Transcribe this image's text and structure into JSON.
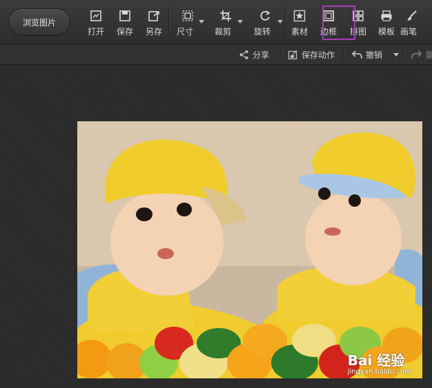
{
  "toolbar": {
    "browse_label": "浏览图片",
    "tools": [
      {
        "name": "open",
        "label": "打开"
      },
      {
        "name": "save",
        "label": "保存"
      },
      {
        "name": "save-as",
        "label": "另存"
      },
      {
        "name": "size",
        "label": "尺寸"
      },
      {
        "name": "crop",
        "label": "裁剪"
      },
      {
        "name": "rotate",
        "label": "旋转"
      },
      {
        "name": "material",
        "label": "素材"
      },
      {
        "name": "border",
        "label": "边框"
      },
      {
        "name": "collage",
        "label": "拼图"
      },
      {
        "name": "template",
        "label": "模板"
      },
      {
        "name": "brush",
        "label": "画笔"
      }
    ],
    "highlighted_tool": "border",
    "highlight_color": "#a23fb3"
  },
  "subbar": {
    "share_label": "分享",
    "save_action_label": "保存动作",
    "undo_label": "撤销",
    "redo_label": "重"
  },
  "watermark": {
    "logo_text": "Bai 经验",
    "sub_text": "jingyan.baidu.com"
  }
}
